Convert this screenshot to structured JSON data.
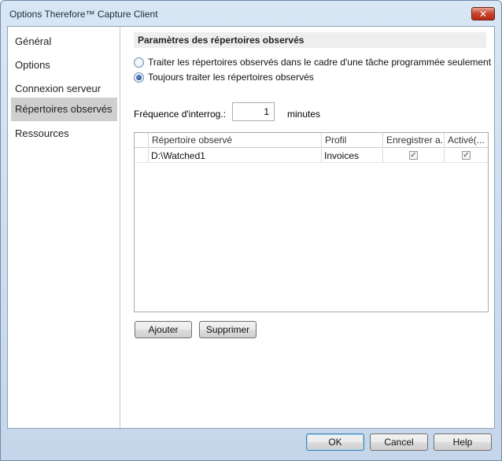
{
  "window": {
    "title": "Options Therefore™ Capture Client",
    "close_glyph": "✕"
  },
  "sidebar": {
    "items": [
      {
        "label": "Général"
      },
      {
        "label": "Options"
      },
      {
        "label": "Connexion serveur"
      },
      {
        "label": "Répertoires observés",
        "selected": true
      },
      {
        "label": "Ressources"
      }
    ]
  },
  "section": {
    "title": "Paramètres des répertoires observés"
  },
  "processing": {
    "option_scheduled": "Traiter les répertoires observés dans le cadre d'une tâche programmée seulement",
    "option_always": "Toujours traiter les répertoires observés",
    "selected": "option_always"
  },
  "polling": {
    "label": "Fréquence d'interrog.:",
    "value": "1",
    "unit": "minutes"
  },
  "table": {
    "columns": [
      "Répertoire observé",
      "Profil",
      "Enregistrer a...",
      "Activé(..."
    ],
    "rows": [
      {
        "directory": "D:\\Watched1",
        "profile": "Invoices",
        "save": true,
        "enabled": true
      }
    ]
  },
  "table_buttons": {
    "add": "Ajouter",
    "remove": "Supprimer"
  },
  "footer": {
    "ok": "OK",
    "cancel": "Cancel",
    "help": "Help"
  }
}
